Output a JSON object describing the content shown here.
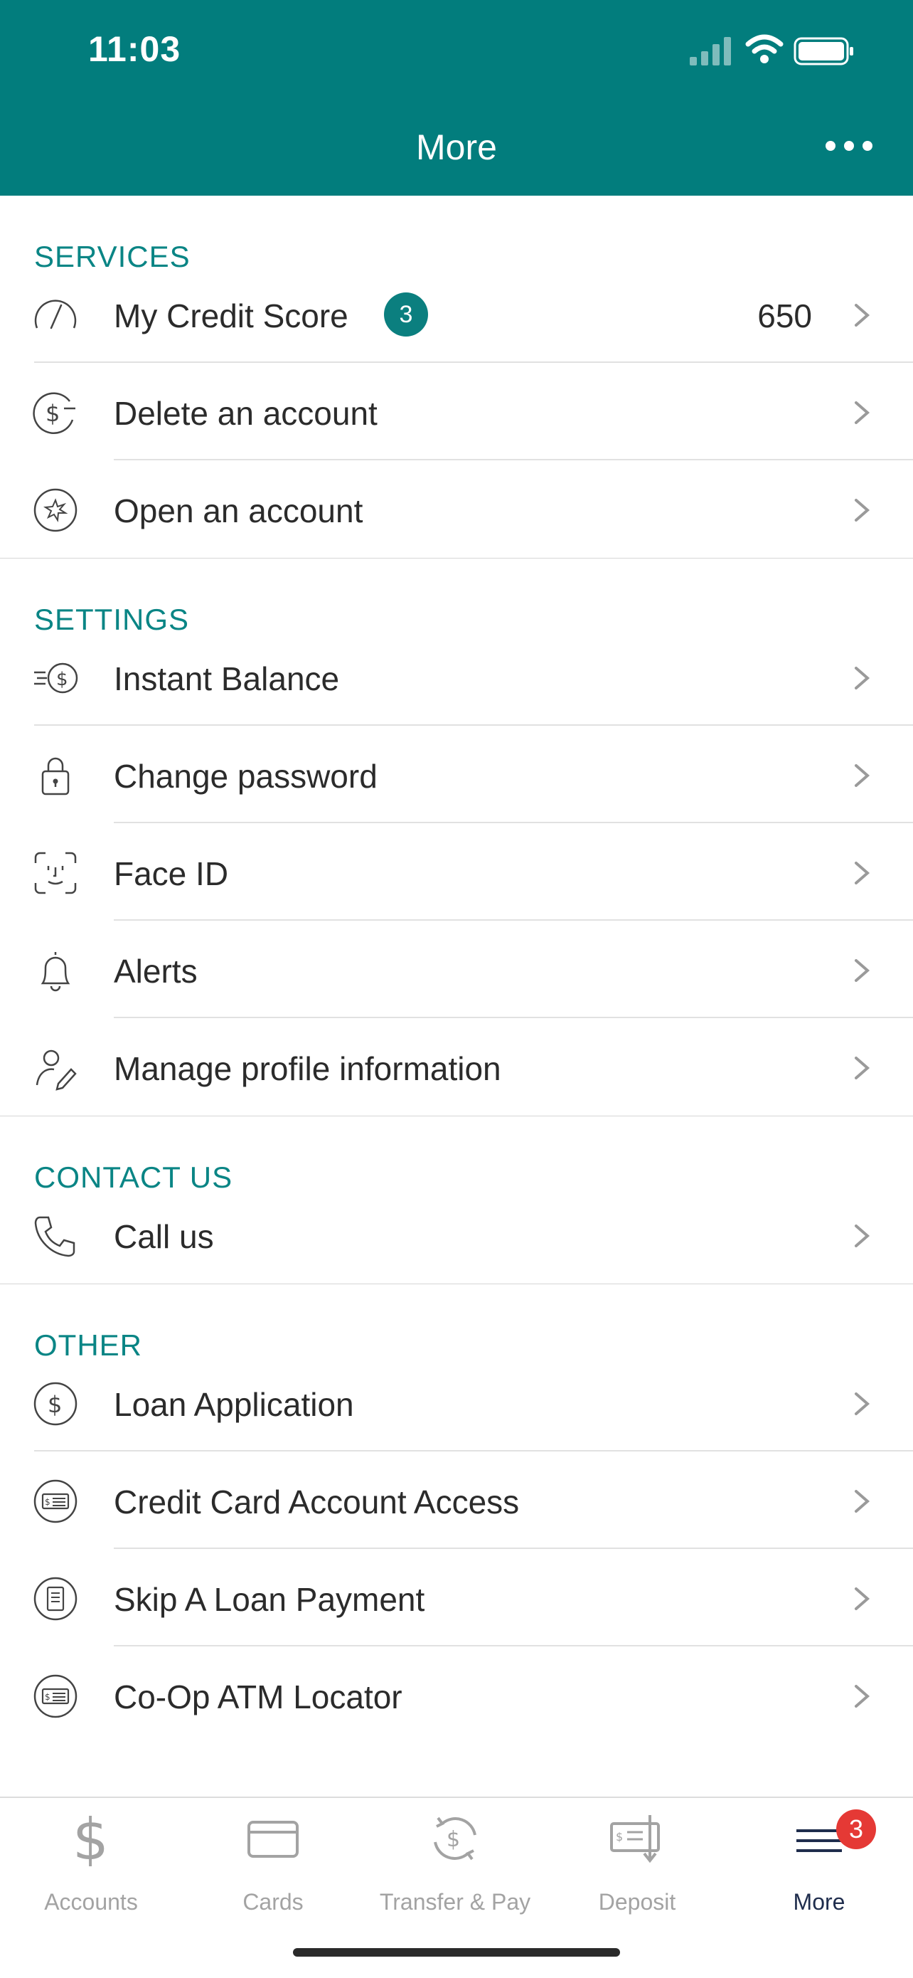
{
  "status": {
    "time": "11:03"
  },
  "header": {
    "title": "More"
  },
  "sections": [
    {
      "title": "SERVICES",
      "items": [
        {
          "label": "My Credit Score",
          "badge": "3",
          "value": "650",
          "icon": "speedometer-icon"
        },
        {
          "label": "Delete an account",
          "icon": "dollar-minus-icon"
        },
        {
          "label": "Open an account",
          "icon": "starburst-icon"
        }
      ]
    },
    {
      "title": "SETTINGS",
      "items": [
        {
          "label": "Instant Balance",
          "icon": "fast-dollar-icon"
        },
        {
          "label": "Change password",
          "icon": "lock-icon"
        },
        {
          "label": "Face ID",
          "icon": "face-id-icon"
        },
        {
          "label": "Alerts",
          "icon": "bell-icon"
        },
        {
          "label": "Manage profile information",
          "icon": "profile-edit-icon"
        }
      ]
    },
    {
      "title": "CONTACT US",
      "items": [
        {
          "label": "Call us",
          "icon": "phone-icon"
        }
      ]
    },
    {
      "title": "OTHER",
      "items": [
        {
          "label": "Loan Application",
          "icon": "dollar-circle-icon"
        },
        {
          "label": "Credit Card Account Access",
          "icon": "check-card-icon"
        },
        {
          "label": "Skip A Loan Payment",
          "icon": "document-icon"
        },
        {
          "label": "Co-Op ATM Locator",
          "icon": "check-card-icon"
        }
      ]
    }
  ],
  "tabs": [
    {
      "label": "Accounts",
      "icon": "dollar-icon"
    },
    {
      "label": "Cards",
      "icon": "card-icon"
    },
    {
      "label": "Transfer & Pay",
      "icon": "transfer-icon"
    },
    {
      "label": "Deposit",
      "icon": "deposit-check-icon"
    },
    {
      "label": "More",
      "icon": "menu-icon",
      "badge": "3",
      "active": true
    }
  ],
  "colors": {
    "brand": "#027d7d",
    "section_title": "#0a8585",
    "badge_red": "#e53935",
    "active_tab": "#1f2d4d"
  }
}
